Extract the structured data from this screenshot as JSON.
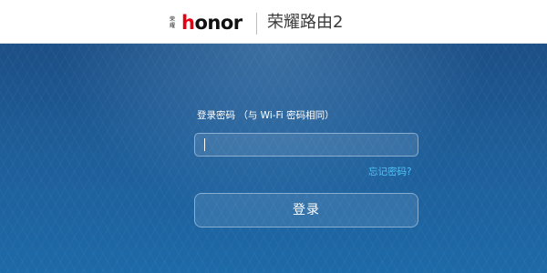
{
  "header": {
    "logo": {
      "chinese_mark": "荣耀",
      "wordmark": "honor"
    },
    "product_title": "荣耀路由2"
  },
  "login": {
    "password_label": "登录密码 （与 Wi-Fi 密码相同）",
    "password_value": "",
    "forgot_link": "忘记密码?",
    "login_button": "登录"
  },
  "colors": {
    "brand_red": "#e60012",
    "link_cyan": "#4fc3f7",
    "background_blue": "#1d5a96"
  }
}
